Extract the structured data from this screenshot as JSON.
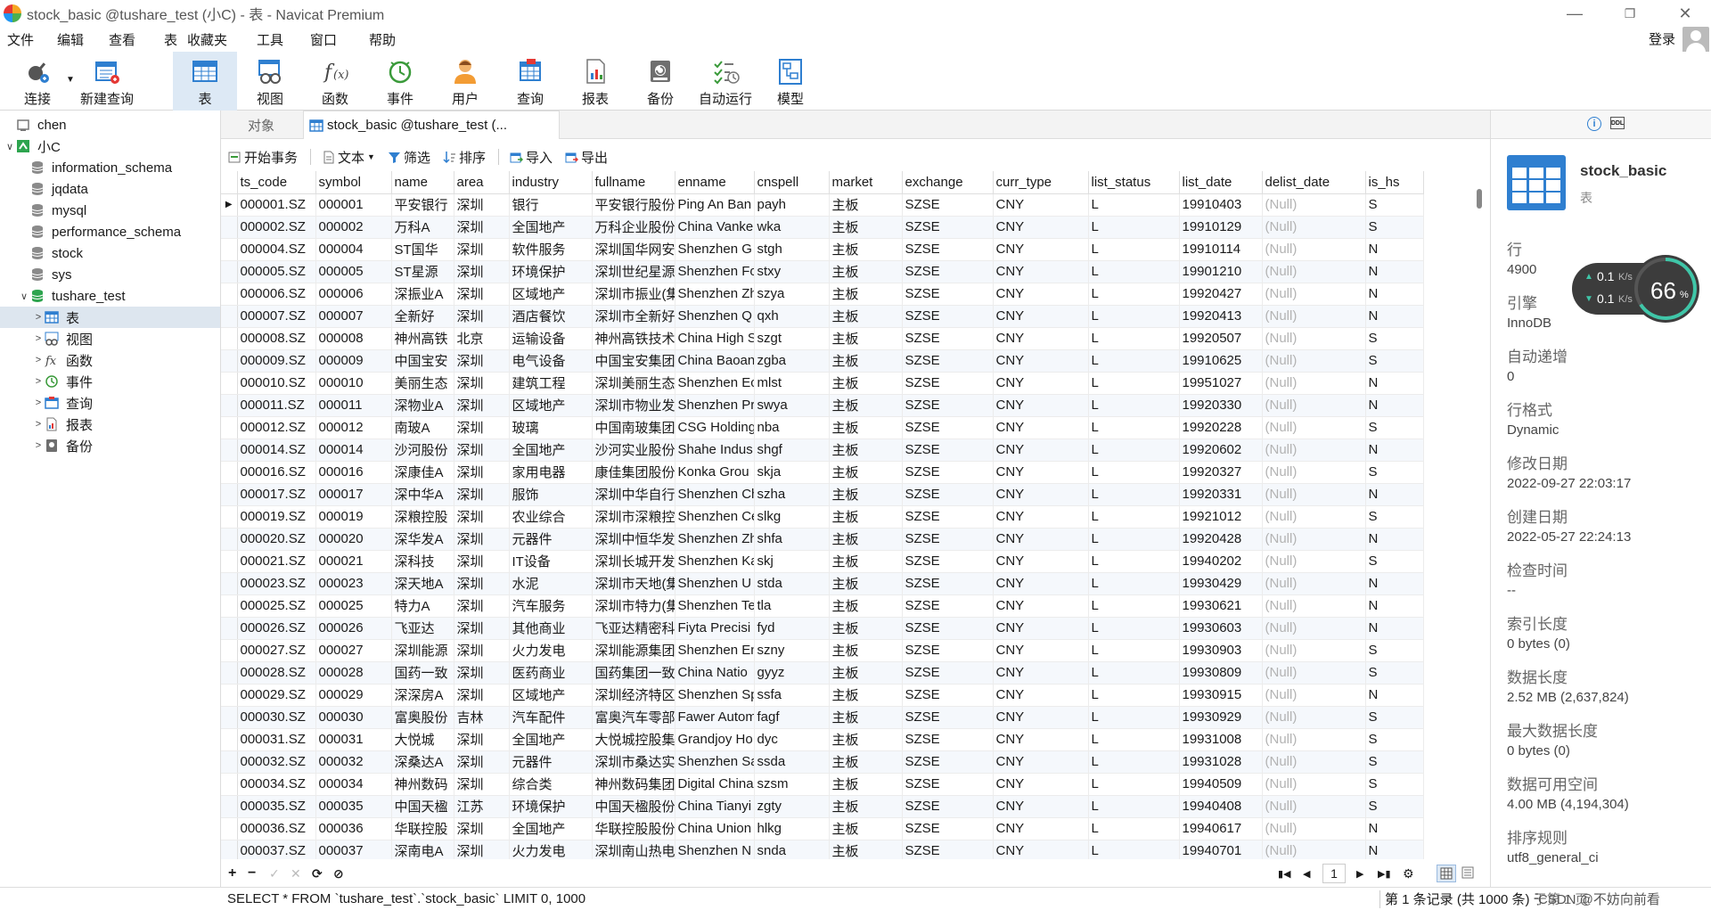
{
  "window": {
    "title": "stock_basic @tushare_test (小C) - 表 - Navicat Premium"
  },
  "menu": [
    "文件",
    "编辑",
    "查看",
    "表",
    "收藏夹",
    "工具",
    "窗口",
    "帮助"
  ],
  "login": "登录",
  "toolbar": [
    {
      "label": "连接",
      "icon": "plug-icon"
    },
    {
      "label": "新建查询",
      "icon": "new-query-icon"
    },
    {
      "label": "表",
      "icon": "table-icon"
    },
    {
      "label": "视图",
      "icon": "view-icon"
    },
    {
      "label": "函数",
      "icon": "function-icon"
    },
    {
      "label": "事件",
      "icon": "clock-icon"
    },
    {
      "label": "用户",
      "icon": "user-icon"
    },
    {
      "label": "查询",
      "icon": "query-icon"
    },
    {
      "label": "报表",
      "icon": "report-icon"
    },
    {
      "label": "备份",
      "icon": "backup-icon"
    },
    {
      "label": "自动运行",
      "icon": "automation-icon"
    },
    {
      "label": "模型",
      "icon": "model-icon"
    }
  ],
  "tree": [
    {
      "label": "chen",
      "level": 0,
      "type": "conn-off",
      "exp": ""
    },
    {
      "label": "小C",
      "level": 0,
      "type": "conn-on",
      "exp": "∨"
    },
    {
      "label": "information_schema",
      "level": 1,
      "type": "db",
      "exp": ""
    },
    {
      "label": "jqdata",
      "level": 1,
      "type": "db",
      "exp": ""
    },
    {
      "label": "mysql",
      "level": 1,
      "type": "db",
      "exp": ""
    },
    {
      "label": "performance_schema",
      "level": 1,
      "type": "db",
      "exp": ""
    },
    {
      "label": "stock",
      "level": 1,
      "type": "db",
      "exp": ""
    },
    {
      "label": "sys",
      "level": 1,
      "type": "db",
      "exp": ""
    },
    {
      "label": "tushare_test",
      "level": 1,
      "type": "db-open",
      "exp": "∨"
    },
    {
      "label": "表",
      "level": 2,
      "type": "table",
      "exp": ">"
    },
    {
      "label": "视图",
      "level": 2,
      "type": "view",
      "exp": ">"
    },
    {
      "label": "函数",
      "level": 2,
      "type": "func",
      "exp": ">"
    },
    {
      "label": "事件",
      "level": 2,
      "type": "event",
      "exp": ">"
    },
    {
      "label": "查询",
      "level": 2,
      "type": "query",
      "exp": ">"
    },
    {
      "label": "报表",
      "level": 2,
      "type": "report",
      "exp": ">"
    },
    {
      "label": "备份",
      "level": 2,
      "type": "backup",
      "exp": ">"
    }
  ],
  "tabs": {
    "objects": "对象",
    "active": "stock_basic @tushare_test (..."
  },
  "subtoolbar": {
    "begin": "开始事务",
    "text": "文本",
    "filter": "筛选",
    "sort": "排序",
    "import": "导入",
    "export": "导出"
  },
  "columns": [
    "ts_code",
    "symbol",
    "name",
    "area",
    "industry",
    "fullname",
    "enname",
    "cnspell",
    "market",
    "exchange",
    "curr_type",
    "list_status",
    "list_date",
    "delist_date",
    "is_hs"
  ],
  "rows": [
    [
      "000001.SZ",
      "000001",
      "平安银行",
      "深圳",
      "银行",
      "平安银行股份",
      "Ping An Ban",
      "payh",
      "主板",
      "SZSE",
      "CNY",
      "L",
      "19910403",
      "(Null)",
      "S"
    ],
    [
      "000002.SZ",
      "000002",
      "万科A",
      "深圳",
      "全国地产",
      "万科企业股份",
      "China Vanke",
      "wka",
      "主板",
      "SZSE",
      "CNY",
      "L",
      "19910129",
      "(Null)",
      "S"
    ],
    [
      "000004.SZ",
      "000004",
      "ST国华",
      "深圳",
      "软件服务",
      "深圳国华网安",
      "Shenzhen G",
      "stgh",
      "主板",
      "SZSE",
      "CNY",
      "L",
      "19910114",
      "(Null)",
      "N"
    ],
    [
      "000005.SZ",
      "000005",
      "ST星源",
      "深圳",
      "环境保护",
      "深圳世纪星源",
      "Shenzhen Fo",
      "stxy",
      "主板",
      "SZSE",
      "CNY",
      "L",
      "19901210",
      "(Null)",
      "N"
    ],
    [
      "000006.SZ",
      "000006",
      "深振业A",
      "深圳",
      "区域地产",
      "深圳市振业(集",
      "Shenzhen Zh",
      "szya",
      "主板",
      "SZSE",
      "CNY",
      "L",
      "19920427",
      "(Null)",
      "N"
    ],
    [
      "000007.SZ",
      "000007",
      "全新好",
      "深圳",
      "酒店餐饮",
      "深圳市全新好",
      "Shenzhen Q",
      "qxh",
      "主板",
      "SZSE",
      "CNY",
      "L",
      "19920413",
      "(Null)",
      "N"
    ],
    [
      "000008.SZ",
      "000008",
      "神州高铁",
      "北京",
      "运输设备",
      "神州高铁技术",
      "China High S",
      "szgt",
      "主板",
      "SZSE",
      "CNY",
      "L",
      "19920507",
      "(Null)",
      "S"
    ],
    [
      "000009.SZ",
      "000009",
      "中国宝安",
      "深圳",
      "电气设备",
      "中国宝安集团",
      "China Baoan",
      "zgba",
      "主板",
      "SZSE",
      "CNY",
      "L",
      "19910625",
      "(Null)",
      "S"
    ],
    [
      "000010.SZ",
      "000010",
      "美丽生态",
      "深圳",
      "建筑工程",
      "深圳美丽生态",
      "Shenzhen Ec",
      "mlst",
      "主板",
      "SZSE",
      "CNY",
      "L",
      "19951027",
      "(Null)",
      "N"
    ],
    [
      "000011.SZ",
      "000011",
      "深物业A",
      "深圳",
      "区域地产",
      "深圳市物业发",
      "Shenzhen Pr",
      "swya",
      "主板",
      "SZSE",
      "CNY",
      "L",
      "19920330",
      "(Null)",
      "N"
    ],
    [
      "000012.SZ",
      "000012",
      "南玻A",
      "深圳",
      "玻璃",
      "中国南玻集团",
      "CSG Holding",
      "nba",
      "主板",
      "SZSE",
      "CNY",
      "L",
      "19920228",
      "(Null)",
      "S"
    ],
    [
      "000014.SZ",
      "000014",
      "沙河股份",
      "深圳",
      "全国地产",
      "沙河实业股份",
      "Shahe Indus",
      "shgf",
      "主板",
      "SZSE",
      "CNY",
      "L",
      "19920602",
      "(Null)",
      "N"
    ],
    [
      "000016.SZ",
      "000016",
      "深康佳A",
      "深圳",
      "家用电器",
      "康佳集团股份",
      "Konka Grou",
      "skja",
      "主板",
      "SZSE",
      "CNY",
      "L",
      "19920327",
      "(Null)",
      "S"
    ],
    [
      "000017.SZ",
      "000017",
      "深中华A",
      "深圳",
      "服饰",
      "深圳中华自行",
      "Shenzhen Ch",
      "szha",
      "主板",
      "SZSE",
      "CNY",
      "L",
      "19920331",
      "(Null)",
      "N"
    ],
    [
      "000019.SZ",
      "000019",
      "深粮控股",
      "深圳",
      "农业综合",
      "深圳市深粮控",
      "Shenzhen Ce",
      "slkg",
      "主板",
      "SZSE",
      "CNY",
      "L",
      "19921012",
      "(Null)",
      "S"
    ],
    [
      "000020.SZ",
      "000020",
      "深华发A",
      "深圳",
      "元器件",
      "深圳中恒华发",
      "Shenzhen Zh",
      "shfa",
      "主板",
      "SZSE",
      "CNY",
      "L",
      "19920428",
      "(Null)",
      "N"
    ],
    [
      "000021.SZ",
      "000021",
      "深科技",
      "深圳",
      "IT设备",
      "深圳长城开发",
      "Shenzhen Ka",
      "skj",
      "主板",
      "SZSE",
      "CNY",
      "L",
      "19940202",
      "(Null)",
      "S"
    ],
    [
      "000023.SZ",
      "000023",
      "深天地A",
      "深圳",
      "水泥",
      "深圳市天地(集",
      "Shenzhen U",
      "stda",
      "主板",
      "SZSE",
      "CNY",
      "L",
      "19930429",
      "(Null)",
      "N"
    ],
    [
      "000025.SZ",
      "000025",
      "特力A",
      "深圳",
      "汽车服务",
      "深圳市特力(集",
      "Shenzhen Te",
      "tla",
      "主板",
      "SZSE",
      "CNY",
      "L",
      "19930621",
      "(Null)",
      "N"
    ],
    [
      "000026.SZ",
      "000026",
      "飞亚达",
      "深圳",
      "其他商业",
      "飞亚达精密科",
      "Fiyta Precisi",
      "fyd",
      "主板",
      "SZSE",
      "CNY",
      "L",
      "19930603",
      "(Null)",
      "N"
    ],
    [
      "000027.SZ",
      "000027",
      "深圳能源",
      "深圳",
      "火力发电",
      "深圳能源集团",
      "Shenzhen En",
      "szny",
      "主板",
      "SZSE",
      "CNY",
      "L",
      "19930903",
      "(Null)",
      "S"
    ],
    [
      "000028.SZ",
      "000028",
      "国药一致",
      "深圳",
      "医药商业",
      "国药集团一致",
      "China Natio",
      "gyyz",
      "主板",
      "SZSE",
      "CNY",
      "L",
      "19930809",
      "(Null)",
      "S"
    ],
    [
      "000029.SZ",
      "000029",
      "深深房A",
      "深圳",
      "区域地产",
      "深圳经济特区",
      "Shenzhen Sp",
      "ssfa",
      "主板",
      "SZSE",
      "CNY",
      "L",
      "19930915",
      "(Null)",
      "N"
    ],
    [
      "000030.SZ",
      "000030",
      "富奥股份",
      "吉林",
      "汽车配件",
      "富奥汽车零部",
      "Fawer Autom",
      "fagf",
      "主板",
      "SZSE",
      "CNY",
      "L",
      "19930929",
      "(Null)",
      "S"
    ],
    [
      "000031.SZ",
      "000031",
      "大悦城",
      "深圳",
      "全国地产",
      "大悦城控股集",
      "Grandjoy Ho",
      "dyc",
      "主板",
      "SZSE",
      "CNY",
      "L",
      "19931008",
      "(Null)",
      "S"
    ],
    [
      "000032.SZ",
      "000032",
      "深桑达A",
      "深圳",
      "元器件",
      "深圳市桑达实",
      "Shenzhen Sa",
      "ssda",
      "主板",
      "SZSE",
      "CNY",
      "L",
      "19931028",
      "(Null)",
      "S"
    ],
    [
      "000034.SZ",
      "000034",
      "神州数码",
      "深圳",
      "综合类",
      "神州数码集团",
      "Digital China",
      "szsm",
      "主板",
      "SZSE",
      "CNY",
      "L",
      "19940509",
      "(Null)",
      "S"
    ],
    [
      "000035.SZ",
      "000035",
      "中国天楹",
      "江苏",
      "环境保护",
      "中国天楹股份",
      "China Tianyi",
      "zgty",
      "主板",
      "SZSE",
      "CNY",
      "L",
      "19940408",
      "(Null)",
      "S"
    ],
    [
      "000036.SZ",
      "000036",
      "华联控股",
      "深圳",
      "全国地产",
      "华联控股股份",
      "China Union",
      "hlkg",
      "主板",
      "SZSE",
      "CNY",
      "L",
      "19940617",
      "(Null)",
      "N"
    ],
    [
      "000037.SZ",
      "000037",
      "深南电A",
      "深圳",
      "火力发电",
      "深圳南山热电",
      "Shenzhen N",
      "snda",
      "主板",
      "SZSE",
      "CNY",
      "L",
      "19940701",
      "(Null)",
      "N"
    ]
  ],
  "pager": {
    "page": "1"
  },
  "status": {
    "sql": "SELECT * FROM `tushare_test`.`stock_basic` LIMIT 0, 1000",
    "records": "第 1 条记录 (共 1000 条) 于第 1 页"
  },
  "info": {
    "table_name": "stock_basic",
    "table_type": "表",
    "items": [
      {
        "label": "行",
        "value": "4900"
      },
      {
        "label": "引擎",
        "value": "InnoDB"
      },
      {
        "label": "自动递增",
        "value": "0"
      },
      {
        "label": "行格式",
        "value": "Dynamic"
      },
      {
        "label": "修改日期",
        "value": "2022-09-27 22:03:17"
      },
      {
        "label": "创建日期",
        "value": "2022-05-27 22:24:13"
      },
      {
        "label": "检查时间",
        "value": "--"
      },
      {
        "label": "索引长度",
        "value": "0 bytes (0)"
      },
      {
        "label": "数据长度",
        "value": "2.52 MB (2,637,824)"
      },
      {
        "label": "最大数据长度",
        "value": "0 bytes (0)"
      },
      {
        "label": "数据可用空间",
        "value": "4.00 MB (4,194,304)"
      },
      {
        "label": "排序规则",
        "value": "utf8_general_ci"
      }
    ]
  },
  "net": {
    "up": "0.1",
    "down": "0.1",
    "unit": "K/s",
    "percent": "66",
    "pct_sign": "%"
  },
  "watermark": "CSDN @不妨向前看",
  "colors": {
    "accent": "#2f7fd0",
    "selection": "#dde9f5",
    "null_text": "#b3b3b3",
    "gauge": "#3fc6a8"
  }
}
